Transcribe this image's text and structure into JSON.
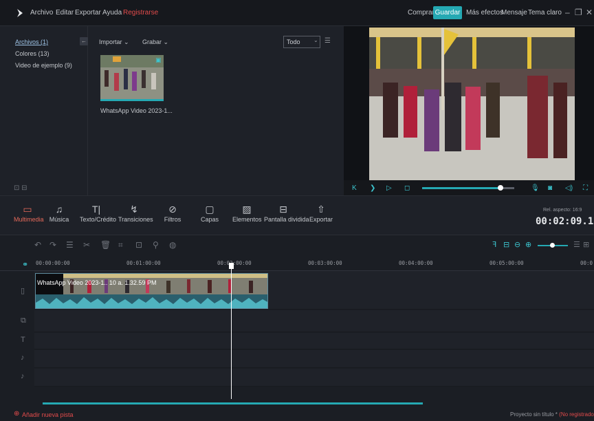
{
  "menu": {
    "file": "Archivo",
    "edit": "Editar",
    "export": "Exportar",
    "help": "Ayuda",
    "register": "Registrarse"
  },
  "top_right": {
    "buy": "Comprar",
    "save": "Guardar",
    "more_effects": "Más efectos",
    "message": "Mensaje",
    "theme": "Tema claro"
  },
  "media": {
    "tree": [
      {
        "label": "Archivos (1)"
      },
      {
        "label": "Colores (13)"
      },
      {
        "label": "Video de ejemplo (9)"
      }
    ],
    "import_label": "Importar",
    "record_label": "Grabar",
    "filter_value": "Todo",
    "clip_name": "WhatsApp Video 2023-1..."
  },
  "preview": {
    "progress": 0.85
  },
  "toolbar": {
    "items": [
      {
        "label": "Multimedia"
      },
      {
        "label": "Música"
      },
      {
        "label": "Texto/Crédito"
      },
      {
        "label": "Transiciones"
      },
      {
        "label": "Filtros"
      },
      {
        "label": "Capas"
      },
      {
        "label": "Elementos"
      },
      {
        "label": "Pantalla dividida"
      },
      {
        "label": "Exportar"
      }
    ],
    "aspect_ratio": "Rel. aspecto: 16:9",
    "timecode": "00:02:09.16"
  },
  "timeline": {
    "ruler": [
      "00:00:00:00",
      "00:01:00:00",
      "00:02:00:00",
      "00:03:00:00",
      "00:04:00:00",
      "00:05:00:00",
      "00:0"
    ],
    "clip_label": "WhatsApp Video 2023-1.. 10 a. 1.32.59 PM"
  },
  "status": {
    "add_track": "Añadir nueva pista",
    "project": "Proyecto sin título * ",
    "unregistered": "(No registrado)"
  },
  "colors": {
    "accent": "#25a9b3",
    "active_tool": "#e66a5a",
    "register": "#e24b4b"
  }
}
